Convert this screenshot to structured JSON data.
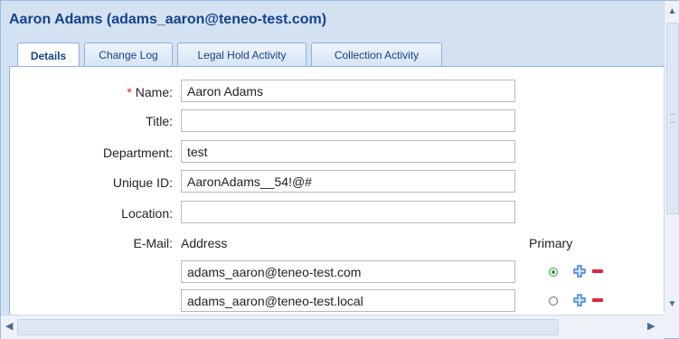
{
  "window": {
    "title": "Aaron Adams (adams_aaron@teneo-test.com)"
  },
  "tabs": [
    {
      "label": "Details",
      "active": true
    },
    {
      "label": "Change Log",
      "active": false
    },
    {
      "label": "Legal Hold Activity",
      "active": false
    },
    {
      "label": "Collection Activity",
      "active": false
    }
  ],
  "form": {
    "required_marker": "*",
    "name": {
      "label": "Name:",
      "value": "Aaron Adams"
    },
    "title": {
      "label": "Title:",
      "value": ""
    },
    "department": {
      "label": "Department:",
      "value": "test"
    },
    "unique_id": {
      "label": "Unique ID:",
      "value": "AaronAdams__54!@#"
    },
    "location": {
      "label": "Location:",
      "value": ""
    },
    "email": {
      "label": "E-Mail:",
      "address_header": "Address",
      "primary_header": "Primary",
      "rows": [
        {
          "address": "adams_aaron@teneo-test.com",
          "primary": true
        },
        {
          "address": "adams_aaron@teneo-test.local",
          "primary": false
        }
      ]
    }
  },
  "icons": {
    "add": "plus-icon",
    "remove": "minus-icon"
  },
  "colors": {
    "title": "#15428b",
    "add_icon": "#3a7fd5",
    "remove_icon": "#e0263a",
    "primary_radio": "#3a9a3a"
  }
}
